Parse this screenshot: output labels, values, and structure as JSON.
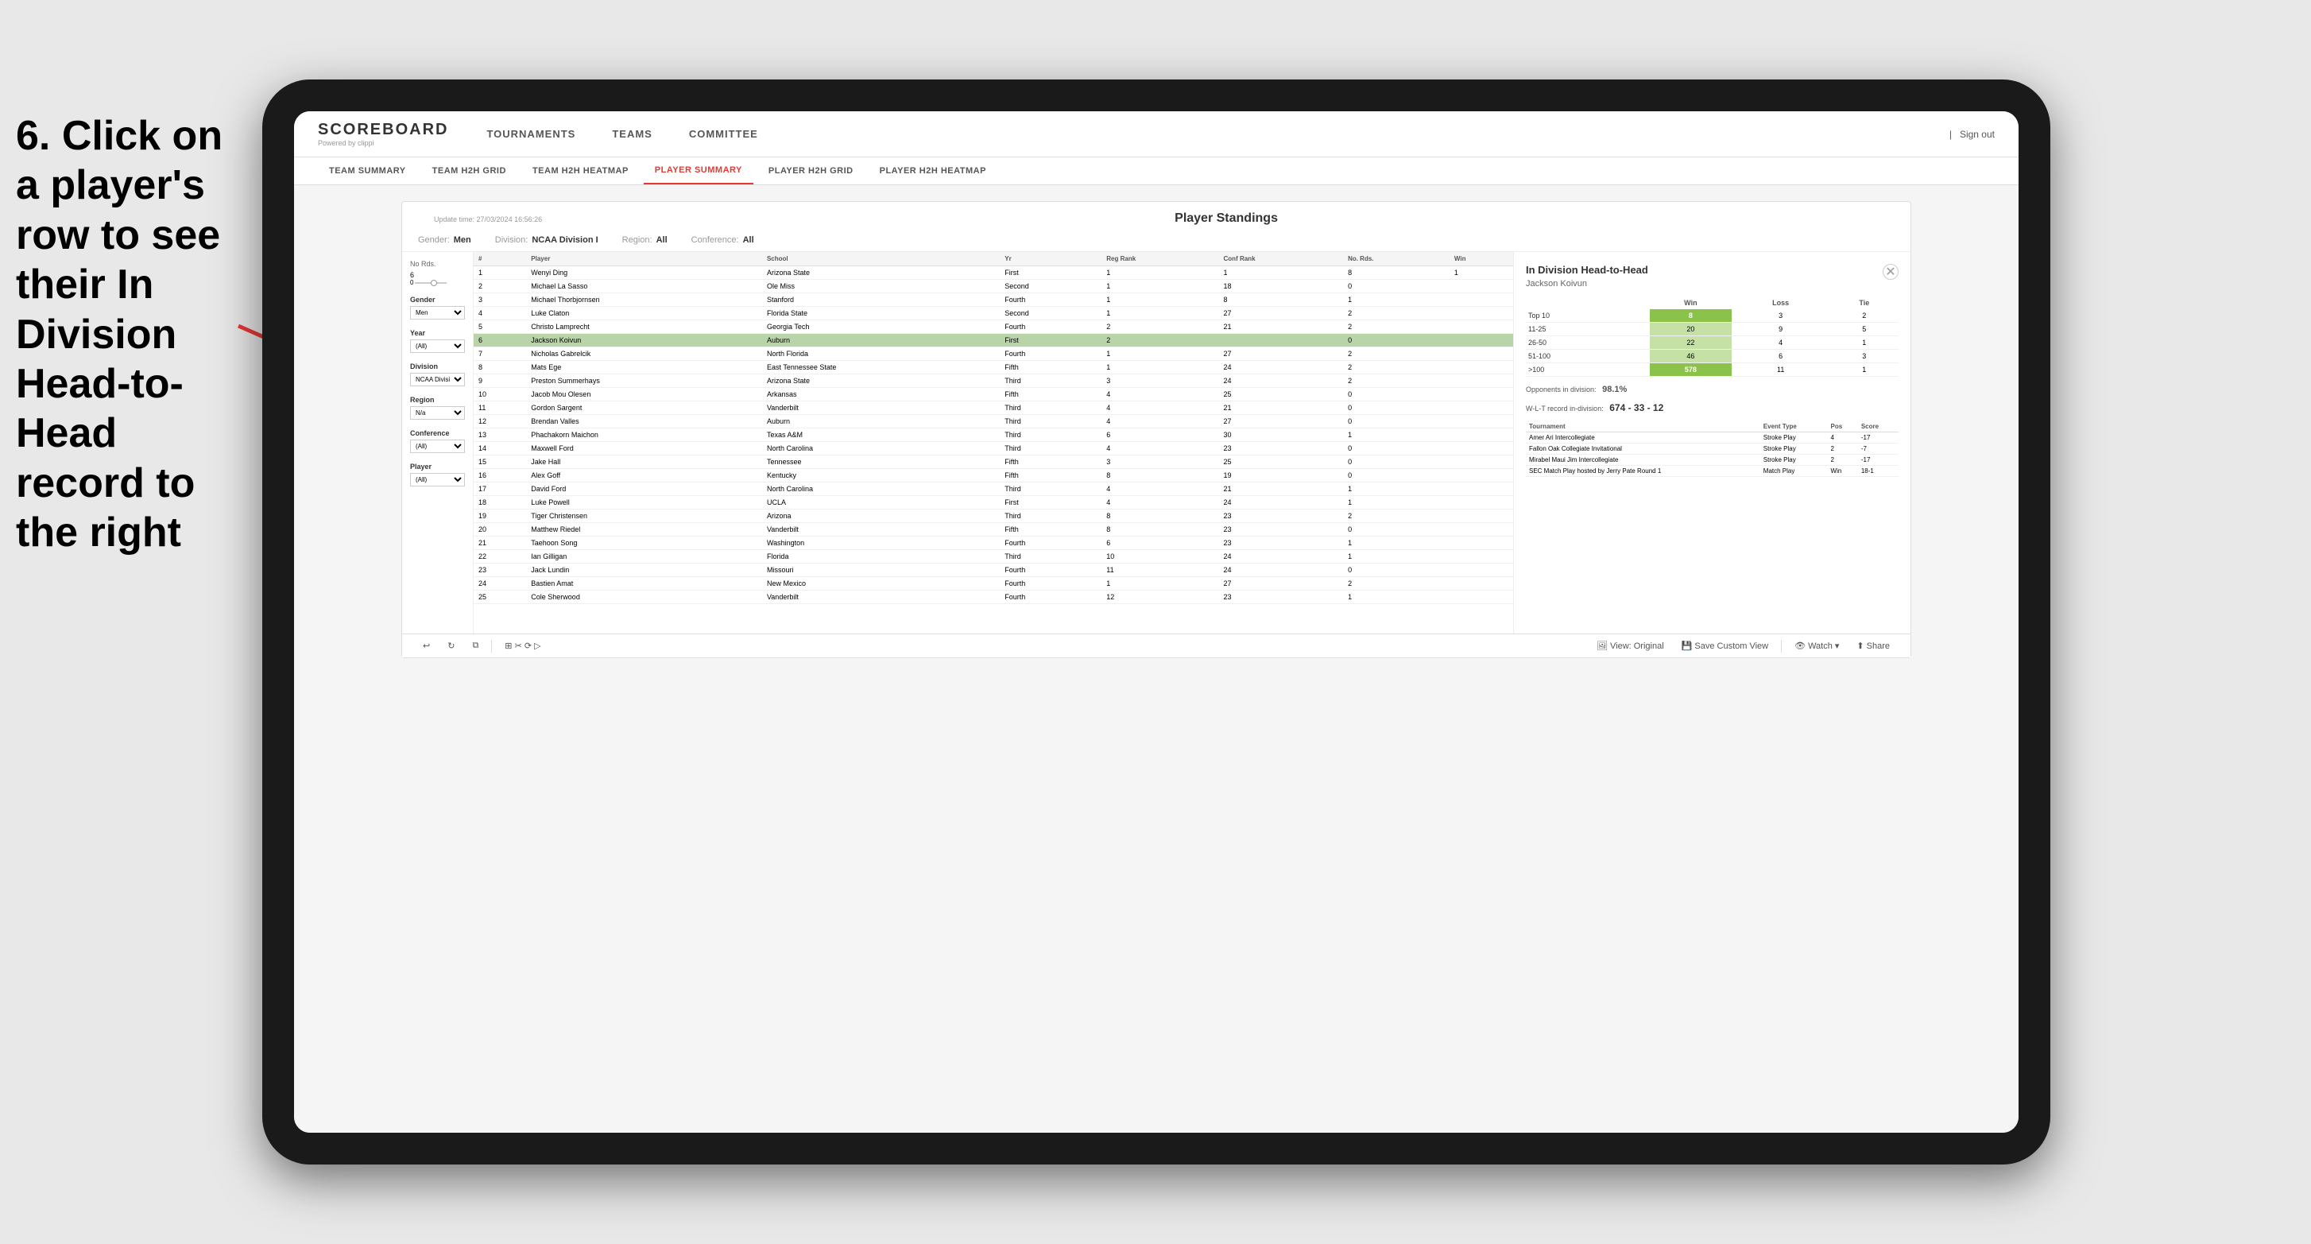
{
  "instruction": {
    "text": "6. Click on a player's row to see their In Division Head-to-Head record to the right"
  },
  "nav": {
    "logo": "SCOREBOARD",
    "powered_by": "Powered by clippi",
    "items": [
      "TOURNAMENTS",
      "TEAMS",
      "COMMITTEE"
    ],
    "sign_out": "Sign out"
  },
  "sub_nav": {
    "items": [
      "TEAM SUMMARY",
      "TEAM H2H GRID",
      "TEAM H2H HEATMAP",
      "PLAYER SUMMARY",
      "PLAYER H2H GRID",
      "PLAYER H2H HEATMAP"
    ],
    "active": "PLAYER SUMMARY"
  },
  "dashboard": {
    "update_time": "Update time: 27/03/2024 16:56:26",
    "title": "Player Standings",
    "filters": {
      "gender": {
        "label": "Gender:",
        "value": "Men"
      },
      "division": {
        "label": "Division:",
        "value": "NCAA Division I"
      },
      "region": {
        "label": "Region:",
        "value": "All"
      },
      "conference": {
        "label": "Conference:",
        "value": "All"
      }
    }
  },
  "sidebar_filters": {
    "no_rds_label": "No Rds.",
    "no_rds_value": "6",
    "gender_label": "Gender",
    "gender_value": "Men",
    "year_label": "Year",
    "year_value": "(All)",
    "division_label": "Division",
    "division_value": "NCAA Division I",
    "region_label": "Region",
    "region_value": "N/a",
    "conference_label": "Conference",
    "conference_value": "(All)",
    "player_label": "Player",
    "player_value": "(All)"
  },
  "player_table": {
    "headers": [
      "#",
      "Player",
      "School",
      "Yr",
      "Reg Rank",
      "Conf Rank",
      "No. Rds.",
      "Win"
    ],
    "rows": [
      {
        "num": "1",
        "player": "Wenyi Ding",
        "school": "Arizona State",
        "yr": "First",
        "reg": "1",
        "conf": "1",
        "rds": "8",
        "win": "1",
        "selected": false
      },
      {
        "num": "2",
        "player": "Michael La Sasso",
        "school": "Ole Miss",
        "yr": "Second",
        "reg": "1",
        "conf": "18",
        "rds": "0",
        "win": "",
        "selected": false
      },
      {
        "num": "3",
        "player": "Michael Thorbjornsen",
        "school": "Stanford",
        "yr": "Fourth",
        "reg": "1",
        "conf": "8",
        "rds": "1",
        "win": "",
        "selected": false
      },
      {
        "num": "4",
        "player": "Luke Claton",
        "school": "Florida State",
        "yr": "Second",
        "reg": "1",
        "conf": "27",
        "rds": "2",
        "win": "",
        "selected": false
      },
      {
        "num": "5",
        "player": "Christo Lamprecht",
        "school": "Georgia Tech",
        "yr": "Fourth",
        "reg": "2",
        "conf": "21",
        "rds": "2",
        "win": "",
        "selected": false
      },
      {
        "num": "6",
        "player": "Jackson Koivun",
        "school": "Auburn",
        "yr": "First",
        "reg": "2",
        "conf": "",
        "rds": "0",
        "win": "",
        "selected": true
      },
      {
        "num": "7",
        "player": "Nicholas Gabrelcik",
        "school": "North Florida",
        "yr": "Fourth",
        "reg": "1",
        "conf": "27",
        "rds": "2",
        "win": "",
        "selected": false
      },
      {
        "num": "8",
        "player": "Mats Ege",
        "school": "East Tennessee State",
        "yr": "Fifth",
        "reg": "1",
        "conf": "24",
        "rds": "2",
        "win": "",
        "selected": false
      },
      {
        "num": "9",
        "player": "Preston Summerhays",
        "school": "Arizona State",
        "yr": "Third",
        "reg": "3",
        "conf": "24",
        "rds": "2",
        "win": "",
        "selected": false
      },
      {
        "num": "10",
        "player": "Jacob Mou Olesen",
        "school": "Arkansas",
        "yr": "Fifth",
        "reg": "4",
        "conf": "25",
        "rds": "0",
        "win": "",
        "selected": false
      },
      {
        "num": "11",
        "player": "Gordon Sargent",
        "school": "Vanderbilt",
        "yr": "Third",
        "reg": "4",
        "conf": "21",
        "rds": "0",
        "win": "",
        "selected": false
      },
      {
        "num": "12",
        "player": "Brendan Valles",
        "school": "Auburn",
        "yr": "Third",
        "reg": "4",
        "conf": "27",
        "rds": "0",
        "win": "",
        "selected": false
      },
      {
        "num": "13",
        "player": "Phachakorn Maichon",
        "school": "Texas A&M",
        "yr": "Third",
        "reg": "6",
        "conf": "30",
        "rds": "1",
        "win": "",
        "selected": false
      },
      {
        "num": "14",
        "player": "Maxwell Ford",
        "school": "North Carolina",
        "yr": "Third",
        "reg": "4",
        "conf": "23",
        "rds": "0",
        "win": "",
        "selected": false
      },
      {
        "num": "15",
        "player": "Jake Hall",
        "school": "Tennessee",
        "yr": "Fifth",
        "reg": "3",
        "conf": "25",
        "rds": "0",
        "win": "",
        "selected": false
      },
      {
        "num": "16",
        "player": "Alex Goff",
        "school": "Kentucky",
        "yr": "Fifth",
        "reg": "8",
        "conf": "19",
        "rds": "0",
        "win": "",
        "selected": false
      },
      {
        "num": "17",
        "player": "David Ford",
        "school": "North Carolina",
        "yr": "Third",
        "reg": "4",
        "conf": "21",
        "rds": "1",
        "win": "",
        "selected": false
      },
      {
        "num": "18",
        "player": "Luke Powell",
        "school": "UCLA",
        "yr": "First",
        "reg": "4",
        "conf": "24",
        "rds": "1",
        "win": "",
        "selected": false
      },
      {
        "num": "19",
        "player": "Tiger Christensen",
        "school": "Arizona",
        "yr": "Third",
        "reg": "8",
        "conf": "23",
        "rds": "2",
        "win": "",
        "selected": false
      },
      {
        "num": "20",
        "player": "Matthew Riedel",
        "school": "Vanderbilt",
        "yr": "Fifth",
        "reg": "8",
        "conf": "23",
        "rds": "0",
        "win": "",
        "selected": false
      },
      {
        "num": "21",
        "player": "Taehoon Song",
        "school": "Washington",
        "yr": "Fourth",
        "reg": "6",
        "conf": "23",
        "rds": "1",
        "win": "",
        "selected": false
      },
      {
        "num": "22",
        "player": "Ian Gilligan",
        "school": "Florida",
        "yr": "Third",
        "reg": "10",
        "conf": "24",
        "rds": "1",
        "win": "",
        "selected": false
      },
      {
        "num": "23",
        "player": "Jack Lundin",
        "school": "Missouri",
        "yr": "Fourth",
        "reg": "11",
        "conf": "24",
        "rds": "0",
        "win": "",
        "selected": false
      },
      {
        "num": "24",
        "player": "Bastien Amat",
        "school": "New Mexico",
        "yr": "Fourth",
        "reg": "1",
        "conf": "27",
        "rds": "2",
        "win": "",
        "selected": false
      },
      {
        "num": "25",
        "player": "Cole Sherwood",
        "school": "Vanderbilt",
        "yr": "Fourth",
        "reg": "12",
        "conf": "23",
        "rds": "1",
        "win": "",
        "selected": false
      }
    ]
  },
  "h2h_panel": {
    "title": "In Division Head-to-Head",
    "player": "Jackson Koivun",
    "table_headers": [
      "Win",
      "Loss",
      "Tie"
    ],
    "table_rows": [
      {
        "label": "Top 10",
        "win": "8",
        "loss": "3",
        "tie": "2",
        "win_class": "green"
      },
      {
        "label": "11-25",
        "win": "20",
        "loss": "9",
        "tie": "5",
        "win_class": "light-green"
      },
      {
        "label": "26-50",
        "win": "22",
        "loss": "4",
        "tie": "1",
        "win_class": "light-green"
      },
      {
        "label": "51-100",
        "win": "46",
        "loss": "6",
        "tie": "3",
        "win_class": "light-green"
      },
      {
        "label": ">100",
        "win": "578",
        "loss": "11",
        "tie": "1",
        "win_class": "green"
      }
    ],
    "opponents_pct_label": "Opponents in division:",
    "opponents_pct": "98.1%",
    "record_label": "W-L-T record in-division:",
    "record": "674 - 33 - 12",
    "tournament_headers": [
      "Tournament",
      "Event Type",
      "Pos",
      "Score"
    ],
    "tournament_rows": [
      {
        "tournament": "Amer Ari Intercollegiate",
        "type": "Stroke Play",
        "pos": "4",
        "score": "-17"
      },
      {
        "tournament": "Fallon Oak Collegiate Invitational",
        "type": "Stroke Play",
        "pos": "2",
        "score": "-7"
      },
      {
        "tournament": "Mirabel Maui Jim Intercollegiate",
        "type": "Stroke Play",
        "pos": "2",
        "score": "-17"
      },
      {
        "tournament": "SEC Match Play hosted by Jerry Pate Round 1",
        "type": "Match Play",
        "pos": "Win",
        "score": "18-1"
      }
    ]
  },
  "toolbar": {
    "undo": "↩",
    "redo": "↪",
    "copy": "⧉",
    "view_original": "View: Original",
    "save_custom": "Save Custom View",
    "watch": "Watch ▾",
    "share": "Share"
  }
}
